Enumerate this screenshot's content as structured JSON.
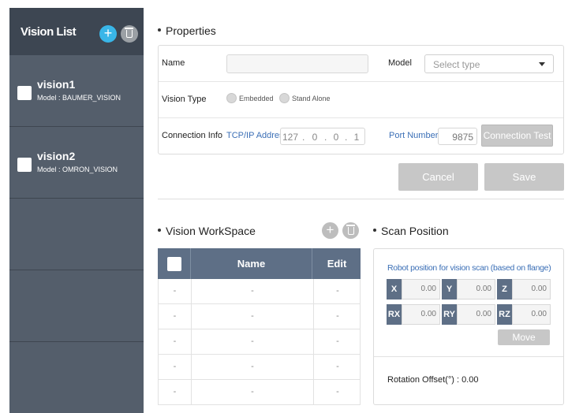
{
  "sidebar": {
    "title": "Vision List",
    "add_icon": "+",
    "items": [
      {
        "name": "vision1",
        "model": "Model : BAUMER_VISION"
      },
      {
        "name": "vision2",
        "model": "Model : OMRON_VISION"
      }
    ]
  },
  "properties": {
    "title": "Properties",
    "name_label": "Name",
    "name_value": "",
    "model_label": "Model",
    "model_placeholder": "Select type",
    "vision_type_label": "Vision Type",
    "vision_type_options": [
      "Embedded",
      "Stand Alone"
    ],
    "connection_label": "Connection Info",
    "tcp_label": "TCP/IP Address",
    "ip": [
      "127",
      "0",
      "0",
      "1"
    ],
    "port_label": "Port Number",
    "port_value": "9875",
    "connection_test_label": "Connection Test"
  },
  "actions": {
    "cancel": "Cancel",
    "save": "Save"
  },
  "workspace": {
    "title": "Vision WorkSpace",
    "add_icon": "+",
    "columns": [
      "Name",
      "Edit"
    ],
    "rows": [
      [
        "-",
        "-",
        "-"
      ],
      [
        "-",
        "-",
        "-"
      ],
      [
        "-",
        "-",
        "-"
      ],
      [
        "-",
        "-",
        "-"
      ],
      [
        "-",
        "-",
        "-"
      ]
    ]
  },
  "scan": {
    "title": "Scan Position",
    "caption": "Robot position for vision scan (based on flange)",
    "axes": [
      {
        "label": "X",
        "value": "0.00"
      },
      {
        "label": "Y",
        "value": "0.00"
      },
      {
        "label": "Z",
        "value": "0.00"
      },
      {
        "label": "RX",
        "value": "0.00"
      },
      {
        "label": "RY",
        "value": "0.00"
      },
      {
        "label": "RZ",
        "value": "0.00"
      }
    ],
    "move_label": "Move",
    "rotation_offset": "Rotation Offset(°) : 0.00"
  },
  "colors": {
    "sidebar_bg": "#545e6b",
    "header_bg": "#3d4652",
    "accent": "#39b6e8",
    "table_header": "#5e6f86",
    "link_blue": "#3b6fb6"
  }
}
